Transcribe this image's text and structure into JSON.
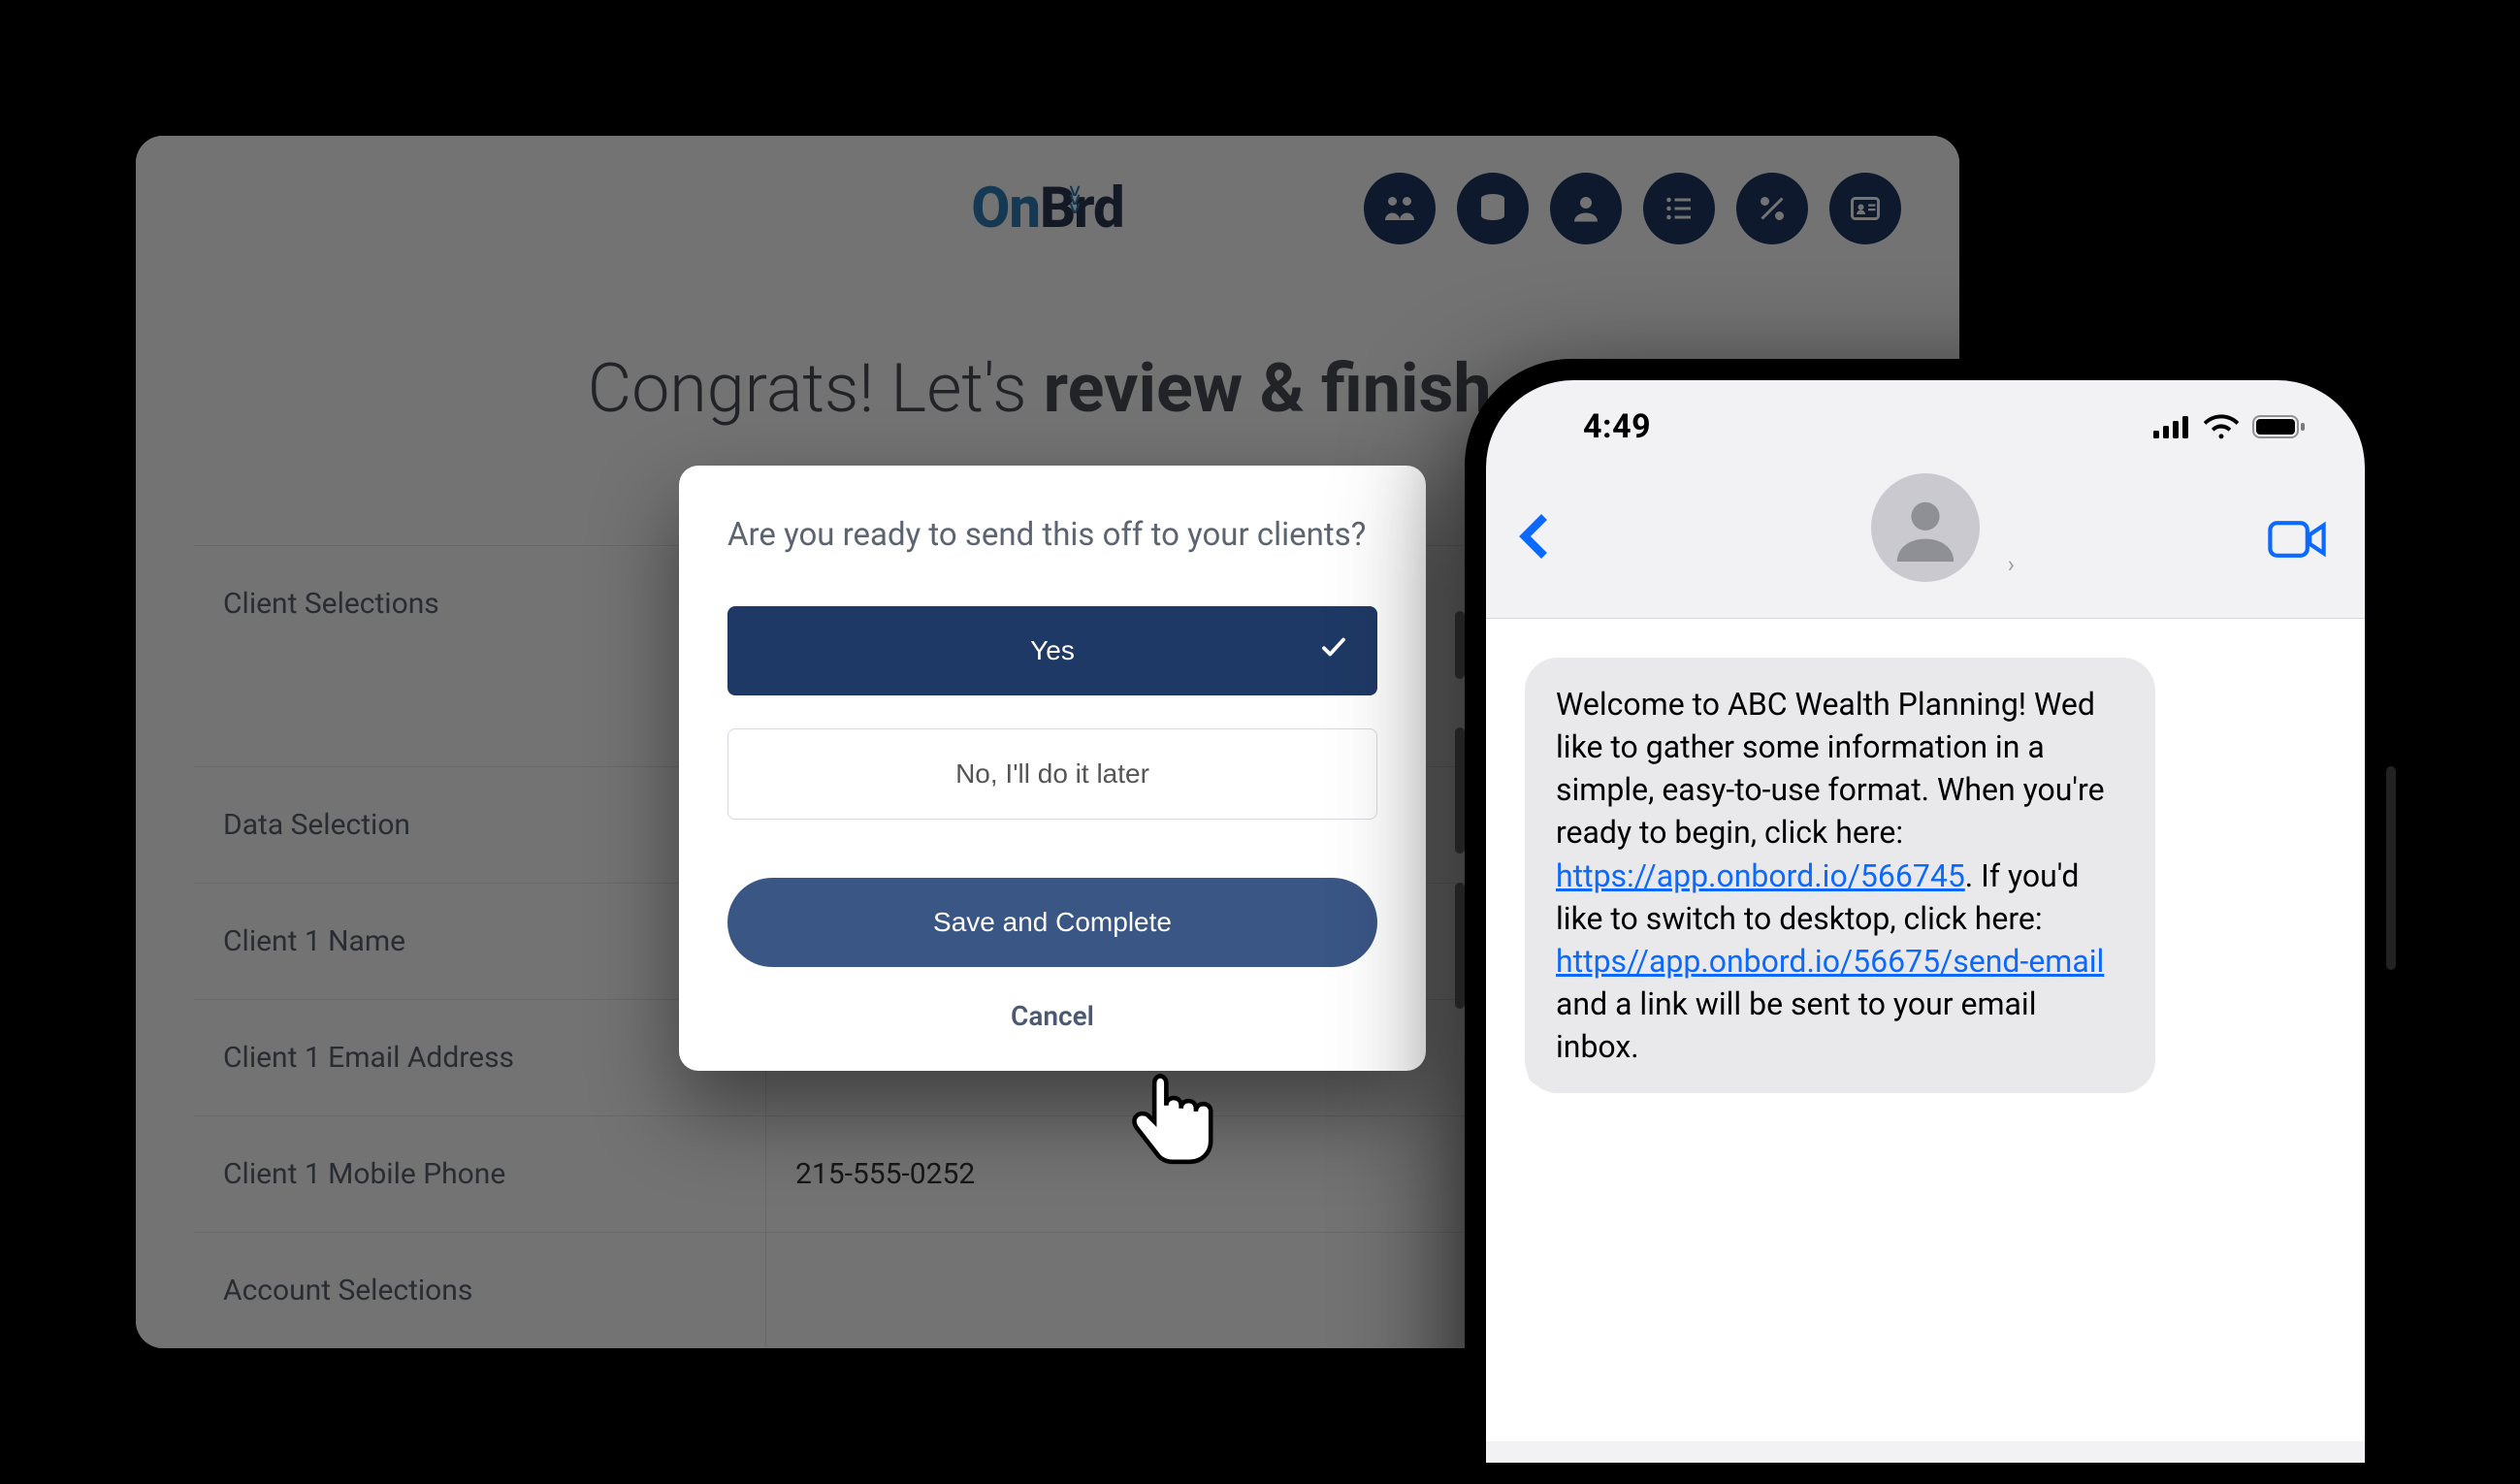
{
  "brand": {
    "part1": "On",
    "part2": "Bord"
  },
  "nav_icons": [
    "people-icon",
    "database-icon",
    "user-icon",
    "list-icon",
    "percent-icon",
    "id-card-icon"
  ],
  "page_title": {
    "light": "Congrats! Let's ",
    "bold": "review & finish",
    "tail": "."
  },
  "review": {
    "rows": [
      {
        "label": "Client Selections",
        "value": ""
      },
      {
        "label": "Data Selection",
        "value": ""
      },
      {
        "label": "Client 1 Name",
        "value": ""
      },
      {
        "label": "Client 1 Email Address",
        "value": ""
      },
      {
        "label": "Client 1 Mobile Phone",
        "value": "215-555-0252"
      },
      {
        "label": "Account Selections",
        "value": ""
      }
    ]
  },
  "modal": {
    "title": "Are you ready to send this off to your clients?",
    "yes": "Yes",
    "no": "No, I'll do it later",
    "save": "Save and Complete",
    "cancel": "Cancel"
  },
  "phone": {
    "time": "4:49",
    "message": {
      "t1": "Welcome to ABC Wealth Planning! Wed like to gather some information in a simple, easy-to-use format. When you're ready to begin, click here: ",
      "link1": "https://app.onbord.io/566745",
      "t2": ". If you'd like to switch to desktop, click here: ",
      "link2": "https//app.onbord.io/56675/send-email",
      "t3": " and a link will be sent to your email inbox."
    }
  }
}
